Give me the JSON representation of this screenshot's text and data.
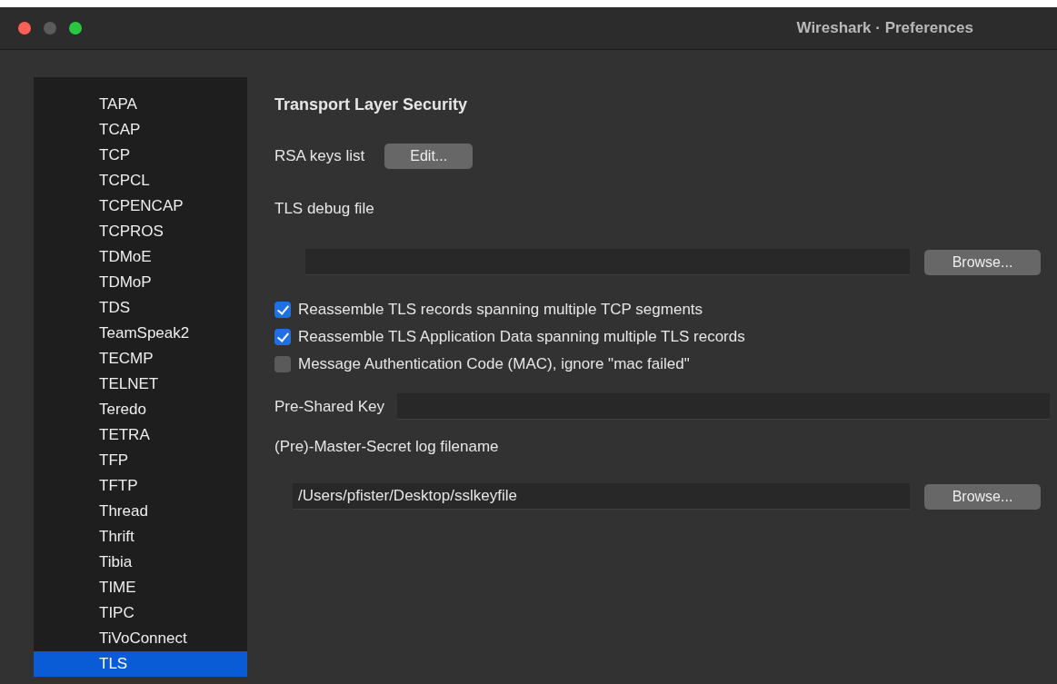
{
  "window": {
    "title": "Wireshark · Preferences"
  },
  "sidebar": {
    "items": [
      {
        "label": "TAPA",
        "selected": false
      },
      {
        "label": "TCAP",
        "selected": false
      },
      {
        "label": "TCP",
        "selected": false
      },
      {
        "label": "TCPCL",
        "selected": false
      },
      {
        "label": "TCPENCAP",
        "selected": false
      },
      {
        "label": "TCPROS",
        "selected": false
      },
      {
        "label": "TDMoE",
        "selected": false
      },
      {
        "label": "TDMoP",
        "selected": false
      },
      {
        "label": "TDS",
        "selected": false
      },
      {
        "label": "TeamSpeak2",
        "selected": false
      },
      {
        "label": "TECMP",
        "selected": false
      },
      {
        "label": "TELNET",
        "selected": false
      },
      {
        "label": "Teredo",
        "selected": false
      },
      {
        "label": "TETRA",
        "selected": false
      },
      {
        "label": "TFP",
        "selected": false
      },
      {
        "label": "TFTP",
        "selected": false
      },
      {
        "label": "Thread",
        "selected": false
      },
      {
        "label": "Thrift",
        "selected": false
      },
      {
        "label": "Tibia",
        "selected": false
      },
      {
        "label": "TIME",
        "selected": false
      },
      {
        "label": "TIPC",
        "selected": false
      },
      {
        "label": "TiVoConnect",
        "selected": false
      },
      {
        "label": "TLS",
        "selected": true
      }
    ]
  },
  "panel": {
    "heading": "Transport Layer Security",
    "rsa_keys": {
      "label": "RSA keys list",
      "button": "Edit..."
    },
    "debug_file": {
      "label": "TLS debug file",
      "button": "Browse..."
    },
    "options": [
      {
        "label": "Reassemble TLS records spanning multiple TCP segments",
        "checked": true
      },
      {
        "label": "Reassemble TLS Application Data spanning multiple TLS records",
        "checked": true
      },
      {
        "label": "Message Authentication Code (MAC), ignore \"mac failed\"",
        "checked": false
      }
    ],
    "psk": {
      "label": "Pre-Shared Key"
    },
    "master_secret": {
      "label": "(Pre)-Master-Secret log filename",
      "value": "/Users/pfister/Desktop/sslkeyfile",
      "button": "Browse..."
    }
  }
}
